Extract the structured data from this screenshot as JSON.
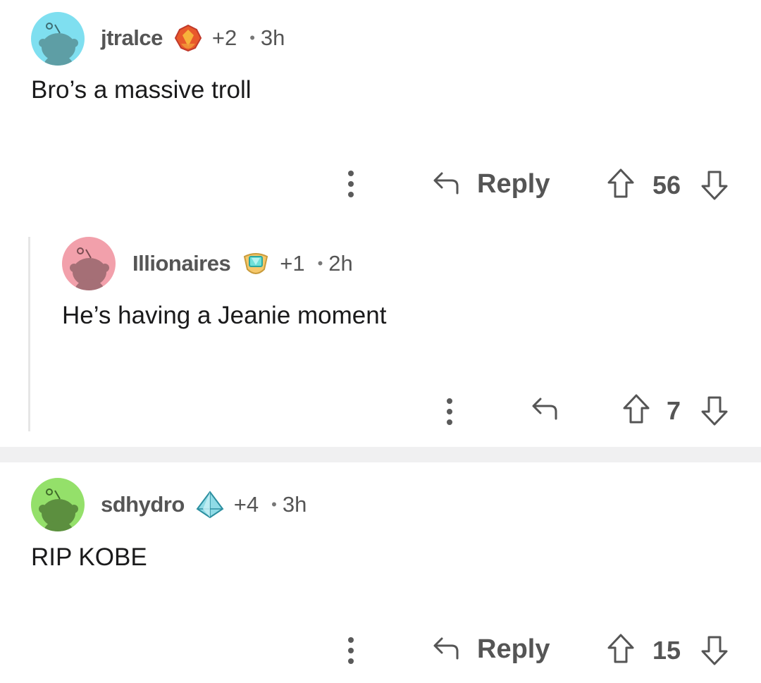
{
  "comments": [
    {
      "username": "jtralce",
      "avatar_color": "#7fdff0",
      "award_icon": "fire-crystal-award-icon",
      "award_count": "+2",
      "time": "3h",
      "body": "Bro’s a massive troll",
      "reply_label": "Reply",
      "score": "56"
    },
    {
      "username": "Illionaires",
      "avatar_color": "#f2a0ab",
      "award_icon": "gem-shield-award-icon",
      "award_count": "+1",
      "time": "2h",
      "body": "He’s having a Jeanie moment",
      "reply_label": "",
      "score": "7"
    },
    {
      "username": "sdhydro",
      "avatar_color": "#94e06a",
      "award_icon": "ice-crystal-award-icon",
      "award_count": "+4",
      "time": "3h",
      "body": "RIP KOBE",
      "reply_label": "Reply",
      "score": "15"
    }
  ],
  "dot_separator": "•",
  "colors": {
    "text_secondary": "#555555",
    "thread_line": "#e6e6e6",
    "separator": "#f0f0f1"
  }
}
